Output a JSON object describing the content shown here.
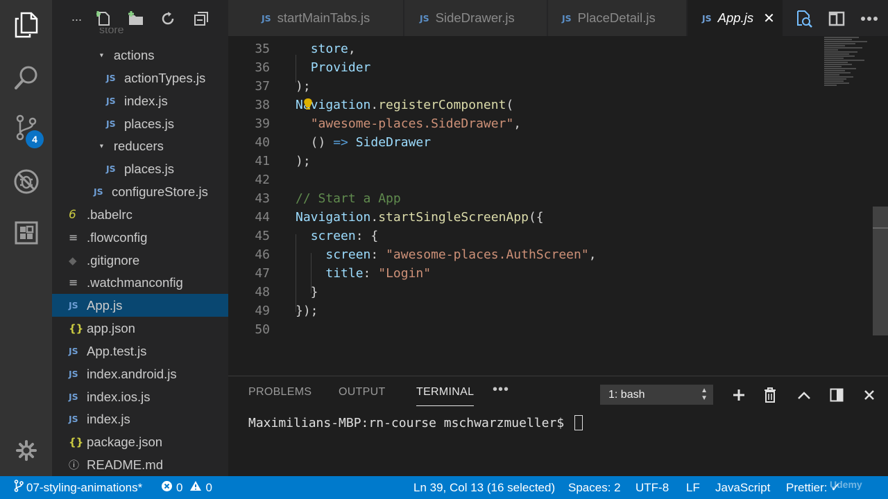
{
  "activity_bar": {
    "items": [
      {
        "icon": "explorer-icon"
      },
      {
        "icon": "search-icon"
      },
      {
        "icon": "source-control-icon",
        "badge": "4"
      },
      {
        "icon": "debug-icon"
      },
      {
        "icon": "extensions-icon"
      },
      {
        "icon": "gear-icon"
      }
    ]
  },
  "sidebar": {
    "header": {
      "more": "...",
      "actions": [
        "new-file-icon",
        "new-folder-icon",
        "refresh-icon",
        "collapse-all-icon"
      ]
    },
    "partial_folder": "store",
    "tree": [
      {
        "label": "actions",
        "type": "folder"
      },
      {
        "label": "actionTypes.js",
        "type": "js",
        "icon_text": "JS"
      },
      {
        "label": "index.js",
        "type": "js",
        "icon_text": "JS"
      },
      {
        "label": "places.js",
        "type": "js",
        "icon_text": "JS"
      },
      {
        "label": "reducers",
        "type": "folder"
      },
      {
        "label": "places.js",
        "type": "js",
        "icon_text": "JS"
      },
      {
        "label": "configureStore.js",
        "type": "js",
        "icon_text": "JS"
      },
      {
        "label": ".babelrc",
        "type": "babel",
        "icon_text": "6"
      },
      {
        "label": ".flowconfig",
        "type": "text",
        "icon_text": "≡"
      },
      {
        "label": ".gitignore",
        "type": "git",
        "icon_text": "◆"
      },
      {
        "label": ".watchmanconfig",
        "type": "text",
        "icon_text": "≡"
      },
      {
        "label": "App.js",
        "type": "js",
        "icon_text": "JS",
        "selected": true
      },
      {
        "label": "app.json",
        "type": "json",
        "icon_text": "{}"
      },
      {
        "label": "App.test.js",
        "type": "js",
        "icon_text": "JS"
      },
      {
        "label": "index.android.js",
        "type": "js",
        "icon_text": "JS"
      },
      {
        "label": "index.ios.js",
        "type": "js",
        "icon_text": "JS"
      },
      {
        "label": "index.js",
        "type": "js",
        "icon_text": "JS"
      },
      {
        "label": "package.json",
        "type": "json",
        "icon_text": "{}"
      },
      {
        "label": "README.md",
        "type": "info",
        "icon_text": "ⓘ"
      }
    ]
  },
  "tabs": [
    {
      "label": "startMainTabs.js",
      "icon_text": "JS"
    },
    {
      "label": "SideDrawer.js",
      "icon_text": "JS"
    },
    {
      "label": "PlaceDetail.js",
      "icon_text": "JS"
    },
    {
      "label": "App.js",
      "icon_text": "JS",
      "active": true,
      "close": "✕"
    }
  ],
  "editor_actions": [
    "open-changes-icon",
    "split-editor-icon",
    "more-actions-icon"
  ],
  "editor": {
    "lines": [
      {
        "num": "35",
        "tokens": [
          {
            "t": "  ",
            "c": "plain"
          },
          {
            "t": "store",
            "c": "var"
          },
          {
            "t": ",",
            "c": "plain"
          }
        ]
      },
      {
        "num": "36",
        "tokens": [
          {
            "t": "  ",
            "c": "plain"
          },
          {
            "t": "Provider",
            "c": "var"
          }
        ]
      },
      {
        "num": "37",
        "tokens": [
          {
            "t": ");",
            "c": "plain"
          }
        ]
      },
      {
        "num": "38",
        "tokens": [
          {
            "t": "Navigation",
            "c": "var"
          },
          {
            "t": ".",
            "c": "plain"
          },
          {
            "t": "registerComponent",
            "c": "fn"
          },
          {
            "t": "(",
            "c": "plain"
          }
        ]
      },
      {
        "num": "39",
        "tokens": [
          {
            "t": "  ",
            "c": "plain"
          },
          {
            "t": "\"awesome-places.SideDrawer\"",
            "c": "str"
          },
          {
            "t": ",",
            "c": "plain"
          }
        ]
      },
      {
        "num": "40",
        "tokens": [
          {
            "t": "  () ",
            "c": "plain"
          },
          {
            "t": "=>",
            "c": "kw"
          },
          {
            "t": " ",
            "c": "plain"
          },
          {
            "t": "SideDrawer",
            "c": "var"
          }
        ]
      },
      {
        "num": "41",
        "tokens": [
          {
            "t": ");",
            "c": "plain"
          }
        ]
      },
      {
        "num": "42",
        "tokens": []
      },
      {
        "num": "43",
        "tokens": [
          {
            "t": "// Start a App",
            "c": "comment"
          }
        ]
      },
      {
        "num": "44",
        "tokens": [
          {
            "t": "Navigation",
            "c": "var"
          },
          {
            "t": ".",
            "c": "plain"
          },
          {
            "t": "startSingleScreenApp",
            "c": "fn"
          },
          {
            "t": "({",
            "c": "plain"
          }
        ]
      },
      {
        "num": "45",
        "tokens": [
          {
            "t": "  ",
            "c": "plain"
          },
          {
            "t": "screen",
            "c": "var"
          },
          {
            "t": ": {",
            "c": "plain"
          }
        ]
      },
      {
        "num": "46",
        "tokens": [
          {
            "t": "    ",
            "c": "plain"
          },
          {
            "t": "screen",
            "c": "var"
          },
          {
            "t": ": ",
            "c": "plain"
          },
          {
            "t": "\"awesome-places.AuthScreen\"",
            "c": "str"
          },
          {
            "t": ",",
            "c": "plain"
          }
        ]
      },
      {
        "num": "47",
        "tokens": [
          {
            "t": "    ",
            "c": "plain"
          },
          {
            "t": "title",
            "c": "var"
          },
          {
            "t": ": ",
            "c": "plain"
          },
          {
            "t": "\"Login\"",
            "c": "str"
          }
        ]
      },
      {
        "num": "48",
        "tokens": [
          {
            "t": "  }",
            "c": "plain"
          }
        ]
      },
      {
        "num": "49",
        "tokens": [
          {
            "t": "});",
            "c": "plain"
          }
        ]
      },
      {
        "num": "50",
        "tokens": []
      }
    ]
  },
  "panel": {
    "tabs": [
      {
        "label": "PROBLEMS"
      },
      {
        "label": "OUTPUT"
      },
      {
        "label": "TERMINAL",
        "active": true
      }
    ],
    "more": "•••",
    "terminal_select": "1: bash",
    "actions": [
      "add-terminal-icon",
      "trash-icon",
      "maximize-panel-icon",
      "toggle-panel-layout-icon",
      "close-panel-icon"
    ],
    "prompt": "Maximilians-MBP:rn-course mschwarzmueller$ "
  },
  "status_bar": {
    "branch": "07-styling-animations*",
    "errors": "0",
    "warnings": "0",
    "position": "Ln 39, Col 13 (16 selected)",
    "spaces": "Spaces: 2",
    "encoding": "UTF-8",
    "eol": "LF",
    "language": "JavaScript",
    "formatter": "Prettier: ✓",
    "watermark": "Udemy"
  },
  "colors": {
    "accent": "#007acc",
    "selection": "#094771",
    "badge": "#0a73c5"
  }
}
